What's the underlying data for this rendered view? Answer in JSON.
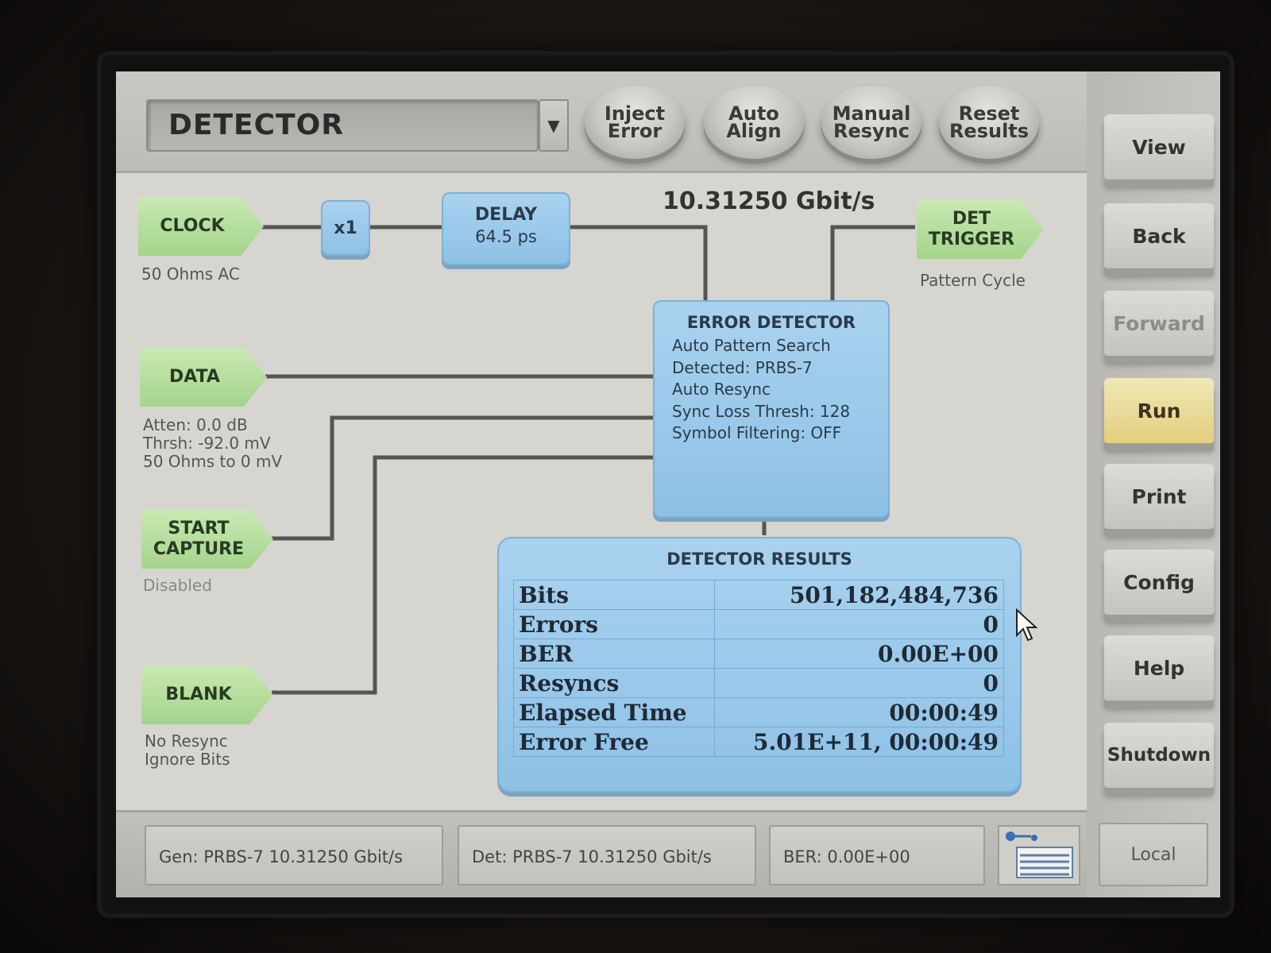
{
  "top_bar": {
    "mode": "DETECTOR",
    "buttons": [
      "Inject\nError",
      "Auto\nAlign",
      "Manual\nResync",
      "Reset\nResults"
    ]
  },
  "side_buttons": [
    {
      "label": "View",
      "state": "normal"
    },
    {
      "label": "Back",
      "state": "normal"
    },
    {
      "label": "Forward",
      "state": "disabled"
    },
    {
      "label": "Run",
      "state": "active"
    },
    {
      "label": "Print",
      "state": "normal"
    },
    {
      "label": "Config",
      "state": "normal"
    },
    {
      "label": "Help",
      "state": "normal"
    },
    {
      "label": "Shutdown",
      "state": "normal"
    }
  ],
  "diagram": {
    "data_rate": "10.31250 Gbit/s",
    "clock": {
      "label": "CLOCK",
      "sub": "50 Ohms AC"
    },
    "multiplier": "x1",
    "delay": {
      "label": "DELAY",
      "value": "64.5 ps"
    },
    "det_trigger": {
      "label": "DET\nTRIGGER",
      "sub": "Pattern Cycle"
    },
    "data": {
      "label": "DATA",
      "sub": "Atten: 0.0 dB\nThrsh: -92.0 mV\n50 Ohms to 0 mV"
    },
    "start_capture": {
      "label": "START\nCAPTURE",
      "sub": "Disabled"
    },
    "blank": {
      "label": "BLANK",
      "sub": "No Resync\nIgnore Bits"
    },
    "error_detector": {
      "title": "ERROR DETECTOR",
      "lines": "Auto Pattern Search\nDetected: PRBS-7\nAuto Resync\nSync Loss Thresh: 128\nSymbol Filtering: OFF"
    }
  },
  "results": {
    "title": "DETECTOR RESULTS",
    "rows": [
      {
        "label": "Bits",
        "value": "501,182,484,736"
      },
      {
        "label": "Errors",
        "value": "0"
      },
      {
        "label": "BER",
        "value": "0.00E+00"
      },
      {
        "label": "Resyncs",
        "value": "0"
      },
      {
        "label": "Elapsed Time",
        "value": "00:00:49"
      },
      {
        "label": "Error Free",
        "value": "5.01E+11, 00:00:49"
      }
    ]
  },
  "status_bar": {
    "gen": "Gen: PRBS-7 10.31250 Gbit/s",
    "det": "Det: PRBS-7 10.31250 Gbit/s",
    "ber": "BER: 0.00E+00",
    "local": "Local"
  },
  "icons": [
    "network-icon",
    "cursor-icon",
    "dropdown-arrow-icon"
  ]
}
